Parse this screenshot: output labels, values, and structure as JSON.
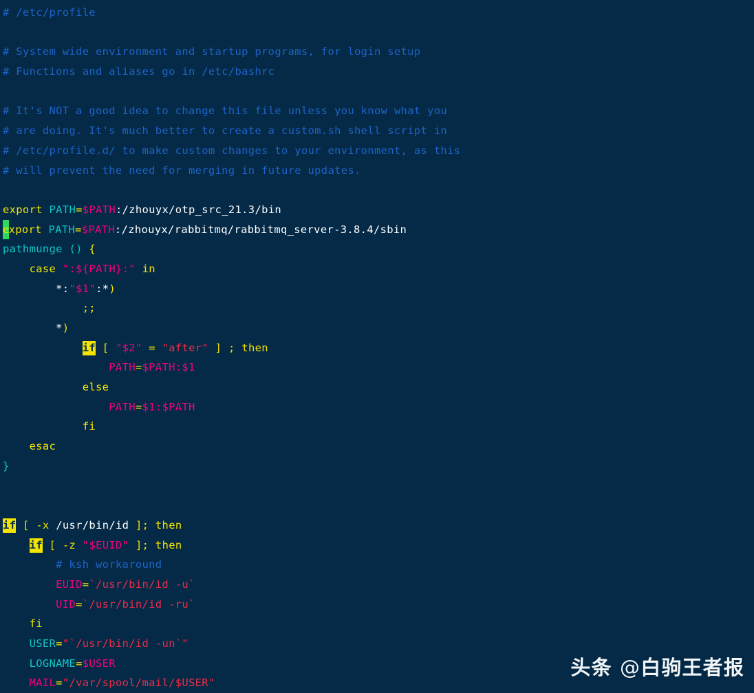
{
  "editor": {
    "title": "/etc/profile",
    "background_color": "#042a47",
    "foreground_color": "#e8eef3",
    "cursor_color": "#2fd95b",
    "highlight_color": "#f5e400",
    "file_type": "shell-script",
    "colors": {
      "comment": "#1e63c8",
      "keyword": "#f5e400",
      "variable": "#f5007f",
      "identifier": "#12c3c3",
      "string": "#ef2b48",
      "plain": "#ffffff",
      "brace": "#12c3c3"
    }
  },
  "watermark": {
    "brand": "头条",
    "at": "@",
    "account": "白驹王者报"
  },
  "code": {
    "lines": [
      "# /etc/profile",
      "",
      "# System wide environment and startup programs, for login setup",
      "# Functions and aliases go in /etc/bashrc",
      "",
      "# It's NOT a good idea to change this file unless you know what you",
      "# are doing. It's much better to create a custom.sh shell script in",
      "# /etc/profile.d/ to make custom changes to your environment, as this",
      "# will prevent the need for merging in future updates.",
      "",
      "export PATH=$PATH:/zhouyx/otp_src_21.3/bin",
      "export PATH=$PATH:/zhouyx/rabbitmq/rabbitmq_server-3.8.4/sbin",
      "pathmunge () {",
      "    case \":${PATH}:\" in",
      "        *:\"$1\":*)",
      "            ;;",
      "        *)",
      "            if [ \"$2\" = \"after\" ] ; then",
      "                PATH=$PATH:$1",
      "            else",
      "                PATH=$1:$PATH",
      "            fi",
      "    esac",
      "}",
      "",
      "",
      "if [ -x /usr/bin/id ]; then",
      "    if [ -z \"$EUID\" ]; then",
      "        # ksh workaround",
      "        EUID=`/usr/bin/id -u`",
      "        UID=`/usr/bin/id -ru`",
      "    fi",
      "    USER=\"`/usr/bin/id -un`\"",
      "    LOGNAME=$USER",
      "    MAIL=\"/var/spool/mail/$USER\""
    ],
    "tokens": [
      [
        [
          "# /etc/profile",
          "comment"
        ]
      ],
      [],
      [
        [
          "# System wide environment and startup programs, for login setup",
          "comment"
        ]
      ],
      [
        [
          "# Functions and aliases go in /etc/bashrc",
          "comment"
        ]
      ],
      [],
      [
        [
          "# It's NOT a good idea to change this file unless you know what you",
          "comment"
        ]
      ],
      [
        [
          "# are doing. It's much better to create a custom.sh shell script in",
          "comment"
        ]
      ],
      [
        [
          "# /etc/profile.d/ to make custom changes to your environment, as this",
          "comment"
        ]
      ],
      [
        [
          "# will prevent the need for merging in future updates.",
          "comment"
        ]
      ],
      [],
      [
        [
          "export",
          "keyword"
        ],
        [
          " ",
          "plain"
        ],
        [
          "PATH",
          "ident"
        ],
        [
          "=",
          "keyword"
        ],
        [
          "$PATH",
          "var"
        ],
        [
          ":/zhouyx/otp_src_21.3/bin",
          "plain"
        ]
      ],
      [
        [
          "e",
          "cursor"
        ],
        [
          "xport",
          "keyword"
        ],
        [
          " ",
          "plain"
        ],
        [
          "PATH",
          "ident"
        ],
        [
          "=",
          "keyword"
        ],
        [
          "$PATH",
          "var"
        ],
        [
          ":/zhouyx/rabbitmq/rabbitmq_server-3.8.4/sbin",
          "plain"
        ]
      ],
      [
        [
          "pathmunge",
          "ident"
        ],
        [
          " ",
          "plain"
        ],
        [
          "()",
          "ident"
        ],
        [
          " ",
          "plain"
        ],
        [
          "{",
          "keyword"
        ]
      ],
      [
        [
          "    ",
          "plain"
        ],
        [
          "case",
          "keyword"
        ],
        [
          " ",
          "plain"
        ],
        [
          "\":",
          "var"
        ],
        [
          "${PATH}",
          "var"
        ],
        [
          ":\"",
          "var"
        ],
        [
          " ",
          "plain"
        ],
        [
          "in",
          "keyword"
        ]
      ],
      [
        [
          "        ",
          "plain"
        ],
        [
          "*",
          "plain"
        ],
        [
          ":",
          "plain"
        ],
        [
          "\"",
          "var"
        ],
        [
          "$1",
          "var"
        ],
        [
          "\"",
          "var"
        ],
        [
          ":",
          "plain"
        ],
        [
          "*",
          "plain"
        ],
        [
          ")",
          "keyword"
        ]
      ],
      [
        [
          "            ",
          ""
        ],
        [
          ";;",
          "keyword"
        ]
      ],
      [
        [
          "        ",
          "plain"
        ],
        [
          "*",
          "plain"
        ],
        [
          ")",
          "keyword"
        ]
      ],
      [
        [
          "            ",
          "plain"
        ],
        [
          "if",
          "hl"
        ],
        [
          " ",
          "plain"
        ],
        [
          "[",
          "keyword"
        ],
        [
          " ",
          "plain"
        ],
        [
          "\"$2\"",
          "var"
        ],
        [
          " ",
          "plain"
        ],
        [
          "=",
          "keyword"
        ],
        [
          " ",
          "plain"
        ],
        [
          "\"after\"",
          "string"
        ],
        [
          " ",
          "plain"
        ],
        [
          "]",
          "keyword"
        ],
        [
          " ",
          "plain"
        ],
        [
          ";",
          "keyword"
        ],
        [
          " ",
          "plain"
        ],
        [
          "then",
          "keyword"
        ]
      ],
      [
        [
          "                ",
          "plain"
        ],
        [
          "PATH",
          "var"
        ],
        [
          "=",
          "keyword"
        ],
        [
          "$PATH",
          "var"
        ],
        [
          ":",
          "var"
        ],
        [
          "$1",
          "var"
        ]
      ],
      [
        [
          "            ",
          "plain"
        ],
        [
          "else",
          "keyword"
        ]
      ],
      [
        [
          "                ",
          "plain"
        ],
        [
          "PATH",
          "var"
        ],
        [
          "=",
          "keyword"
        ],
        [
          "$1",
          "var"
        ],
        [
          ":",
          "var"
        ],
        [
          "$PATH",
          "var"
        ]
      ],
      [
        [
          "            ",
          "plain"
        ],
        [
          "fi",
          "keyword"
        ]
      ],
      [
        [
          "    ",
          "plain"
        ],
        [
          "esac",
          "keyword"
        ]
      ],
      [
        [
          "}",
          "brace"
        ]
      ],
      [],
      [],
      [
        [
          "if",
          "hl"
        ],
        [
          " ",
          "plain"
        ],
        [
          "[",
          "keyword"
        ],
        [
          " ",
          "plain"
        ],
        [
          "-x",
          "keyword"
        ],
        [
          " ",
          "plain"
        ],
        [
          "/usr/bin/id",
          "plain"
        ],
        [
          " ",
          "plain"
        ],
        [
          "]",
          "keyword"
        ],
        [
          ";",
          "keyword"
        ],
        [
          " ",
          "plain"
        ],
        [
          "then",
          "keyword"
        ]
      ],
      [
        [
          "    ",
          "plain"
        ],
        [
          "if",
          "hl"
        ],
        [
          " ",
          "plain"
        ],
        [
          "[",
          "keyword"
        ],
        [
          " ",
          "plain"
        ],
        [
          "-z",
          "keyword"
        ],
        [
          " ",
          "plain"
        ],
        [
          "\"$EUID\"",
          "var"
        ],
        [
          " ",
          "plain"
        ],
        [
          "]",
          "keyword"
        ],
        [
          ";",
          "keyword"
        ],
        [
          " ",
          "plain"
        ],
        [
          "then",
          "keyword"
        ]
      ],
      [
        [
          "        ",
          "plain"
        ],
        [
          "# ksh workaround",
          "comment"
        ]
      ],
      [
        [
          "        ",
          "plain"
        ],
        [
          "EUID",
          "var"
        ],
        [
          "=",
          "keyword"
        ],
        [
          "`/usr/bin/id -u`",
          "string"
        ]
      ],
      [
        [
          "        ",
          "plain"
        ],
        [
          "UID",
          "var"
        ],
        [
          "=",
          "keyword"
        ],
        [
          "`/usr/bin/id -ru`",
          "string"
        ]
      ],
      [
        [
          "    ",
          "plain"
        ],
        [
          "fi",
          "keyword"
        ]
      ],
      [
        [
          "    ",
          "plain"
        ],
        [
          "USER",
          "ident"
        ],
        [
          "=",
          "keyword"
        ],
        [
          "\"`/usr/bin/id -un`\"",
          "string"
        ]
      ],
      [
        [
          "    ",
          "plain"
        ],
        [
          "LOGNAME",
          "ident"
        ],
        [
          "=",
          "keyword"
        ],
        [
          "$USER",
          "var"
        ]
      ],
      [
        [
          "    ",
          "plain"
        ],
        [
          "MAIL",
          "var"
        ],
        [
          "=",
          "keyword"
        ],
        [
          "\"/var/spool/mail/$USER\"",
          "string"
        ]
      ]
    ]
  }
}
